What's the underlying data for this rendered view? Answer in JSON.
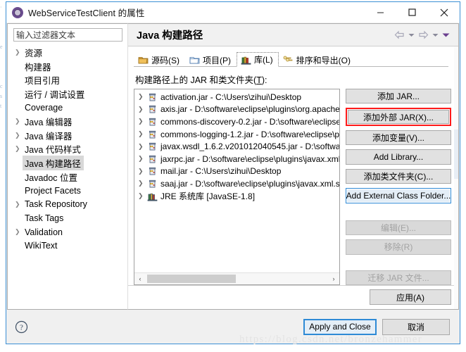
{
  "window": {
    "title": "WebServiceTestClient 的属性",
    "icon": "eclipse-properties-icon",
    "minimize_label": "—",
    "maximize_label": "□",
    "close_label": "✕"
  },
  "sidebar": {
    "filter": {
      "placeholder": "输入过滤器文本",
      "value": ""
    },
    "items": [
      {
        "label": "资源",
        "expandable": true,
        "selected": false
      },
      {
        "label": "构建器",
        "expandable": false,
        "selected": false
      },
      {
        "label": "项目引用",
        "expandable": false,
        "selected": false
      },
      {
        "label": "运行 / 调试设置",
        "expandable": false,
        "selected": false
      },
      {
        "label": "Coverage",
        "expandable": false,
        "selected": false
      },
      {
        "label": "Java 编辑器",
        "expandable": true,
        "selected": false
      },
      {
        "label": "Java 编译器",
        "expandable": true,
        "selected": false
      },
      {
        "label": "Java 代码样式",
        "expandable": true,
        "selected": false
      },
      {
        "label": "Java 构建路径",
        "expandable": false,
        "selected": true
      },
      {
        "label": "Javadoc 位置",
        "expandable": false,
        "selected": false
      },
      {
        "label": "Project Facets",
        "expandable": false,
        "selected": false
      },
      {
        "label": "Task Repository",
        "expandable": true,
        "selected": false
      },
      {
        "label": "Task Tags",
        "expandable": false,
        "selected": false
      },
      {
        "label": "Validation",
        "expandable": true,
        "selected": false
      },
      {
        "label": "WikiText",
        "expandable": false,
        "selected": false
      }
    ]
  },
  "page": {
    "title": "Java 构建路径",
    "nav": {
      "back_icon": "arrow-left-icon",
      "back_menu_icon": "chevron-down-icon",
      "forward_icon": "arrow-right-icon",
      "forward_menu_icon": "chevron-down-icon",
      "view_menu_icon": "triangle-down-icon"
    }
  },
  "tabs": [
    {
      "label": "源码(S)",
      "icon": "source-folder-icon",
      "active": false
    },
    {
      "label": "项目(P)",
      "icon": "project-folder-icon",
      "active": false
    },
    {
      "label": "库(L)",
      "icon": "library-books-icon",
      "active": true
    },
    {
      "label": "排序和导出(O)",
      "icon": "order-export-icon",
      "active": false
    }
  ],
  "list": {
    "label_prefix": "构建路径上的 JAR 和类文件夹(",
    "label_mnemonic": "T",
    "label_suffix": "):",
    "items": [
      {
        "name": "activation.jar",
        "path": "C:\\Users\\zihui\\Desktop",
        "icon": "jar-icon"
      },
      {
        "name": "axis.jar",
        "path": "D:\\software\\eclipse\\plugins\\org.apache",
        "icon": "jar-icon"
      },
      {
        "name": "commons-discovery-0.2.jar",
        "path": "D:\\software\\eclipse",
        "icon": "jar-icon"
      },
      {
        "name": "commons-logging-1.2.jar",
        "path": "D:\\software\\eclipse\\p",
        "icon": "jar-icon"
      },
      {
        "name": "javax.wsdl_1.6.2.v201012040545.jar",
        "path": "D:\\software\\",
        "icon": "jar-icon"
      },
      {
        "name": "jaxrpc.jar",
        "path": "D:\\software\\eclipse\\plugins\\javax.xml.",
        "icon": "jar-icon"
      },
      {
        "name": "mail.jar",
        "path": "C:\\Users\\zihui\\Desktop",
        "icon": "jar-icon"
      },
      {
        "name": "saaj.jar",
        "path": "D:\\software\\eclipse\\plugins\\javax.xml.sc",
        "icon": "jar-icon"
      },
      {
        "name": "JRE 系统库 [JavaSE-1.8]",
        "path": "",
        "icon": "library-books-icon"
      }
    ],
    "separator": "  -  ",
    "scrollbar": {
      "left_arrow": "‹",
      "right_arrow": "›"
    }
  },
  "buttons": {
    "add_jar": {
      "label": "添加 JAR...",
      "state": "normal"
    },
    "add_external_jar": {
      "label": "添加外部 JAR(X)...",
      "state": "highlighted",
      "highlight_color": "#ff1a1a"
    },
    "add_variable": {
      "label": "添加变量(V)...",
      "state": "normal"
    },
    "add_library": {
      "label": "Add Library...",
      "state": "normal"
    },
    "add_class_folder": {
      "label": "添加类文件夹(C)...",
      "state": "normal"
    },
    "add_external_class_folder": {
      "label": "Add External Class Folder...",
      "state": "focused",
      "focus_color": "#2e8ad6"
    },
    "edit": {
      "label": "编辑(E)...",
      "state": "disabled"
    },
    "remove": {
      "label": "移除(R)",
      "state": "disabled"
    },
    "migrate_jar": {
      "label": "迁移 JAR 文件...",
      "state": "disabled"
    },
    "apply": {
      "label": "应用(A)",
      "state": "normal"
    }
  },
  "footer": {
    "help_icon": "help-question-icon",
    "apply_and_close": "Apply and Close",
    "cancel": "取消"
  },
  "watermark": "https://blog.csdn.net/bronzehammer"
}
